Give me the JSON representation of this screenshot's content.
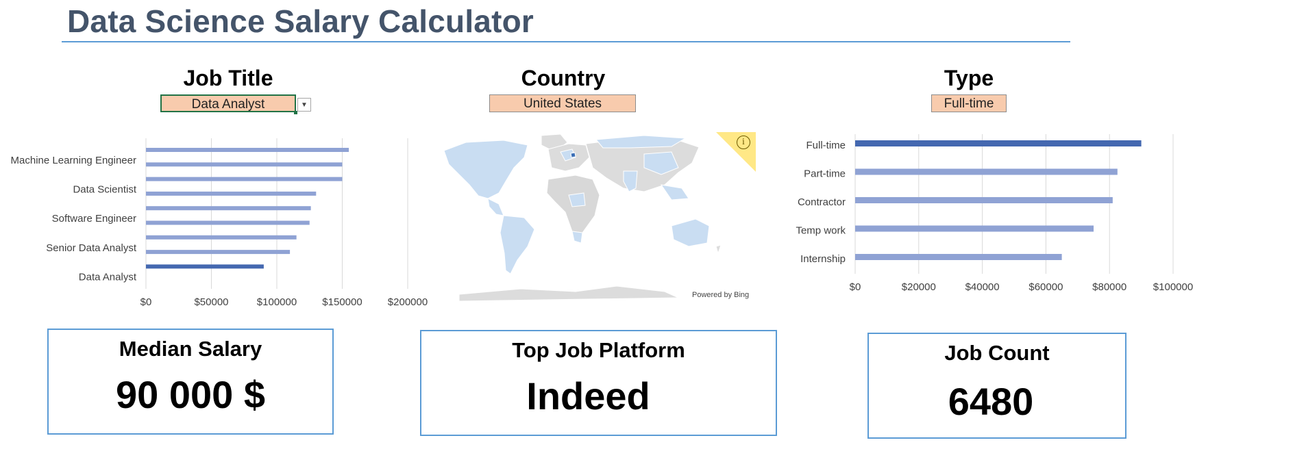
{
  "title": "Data Science Salary Calculator",
  "filters": {
    "job_title": {
      "label": "Job Title",
      "value": "Data Analyst"
    },
    "country": {
      "label": "Country",
      "value": "United States"
    },
    "type": {
      "label": "Type",
      "value": "Full-time"
    }
  },
  "map": {
    "powered_by": "Powered by Bing",
    "info_icon": "info-icon"
  },
  "kpis": {
    "median_salary": {
      "label": "Median Salary",
      "value": "90 000  $"
    },
    "top_platform": {
      "label": "Top Job Platform",
      "value": "Indeed"
    },
    "job_count": {
      "label": "Job Count",
      "value": "6480"
    }
  },
  "colors": {
    "title": "#44546a",
    "bar": "#8fa2d4",
    "bar_highlight": "#4468b0",
    "slicer_fill": "#f8cbad",
    "kpi_border": "#5b9bd5"
  },
  "chart_data": [
    {
      "type": "bar",
      "orientation": "horizontal",
      "title": "",
      "categories": [
        "Machine Learning Engineer",
        "",
        "Data Scientist",
        "",
        "Software Engineer",
        "",
        "Senior Data Analyst",
        "",
        "Data Analyst"
      ],
      "values": [
        155000,
        150000,
        150000,
        130000,
        126000,
        125000,
        115000,
        110000,
        90000
      ],
      "highlight_index": 8,
      "xlim": [
        0,
        200000
      ],
      "xticks": [
        "$0",
        "$50000",
        "$100000",
        "$150000",
        "$200000"
      ],
      "grid": true
    },
    {
      "type": "bar",
      "orientation": "horizontal",
      "title": "",
      "categories": [
        "Full-time",
        "Part-time",
        "Contractor",
        "Temp work",
        "Internship"
      ],
      "values": [
        90000,
        82500,
        81000,
        75000,
        65000
      ],
      "highlight_index": 0,
      "xlim": [
        0,
        100000
      ],
      "xticks": [
        "$0",
        "$20000",
        "$40000",
        "$60000",
        "$80000",
        "$100000"
      ],
      "grid": true
    }
  ]
}
